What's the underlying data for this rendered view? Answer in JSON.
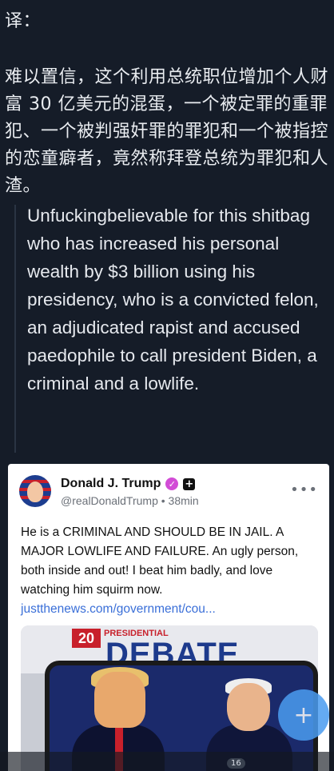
{
  "translation": {
    "label": "译：",
    "text": "难以置信，这个利用总统职位增加个人财富 30 亿美元的混蛋，一个被定罪的重罪犯、一个被判强奸罪的罪犯和一个被指控的恋童癖者，竟然称拜登总统为罪犯和人渣。"
  },
  "quote": {
    "text": "Unfuckingbelievable for this shitbag who has increased his personal wealth by $3 billion using his presidency, who is a convicted felon, an adjudicated rapist and accused paedophile to call president Biden, a criminal and a lowlife."
  },
  "post": {
    "author_name": "Donald J. Trump",
    "handle": "@realDonaldTrump",
    "separator": "•",
    "time": "38min",
    "more_glyph": "•••",
    "body": "He is a CRIMINAL AND SHOULD BE IN JAIL. A MAJOR LOWLIFE AND FAILURE. An ugly person, both inside and out! I beat him badly, and love watching him squirm now.",
    "link": "justthenews.com/government/cou...",
    "media": {
      "number": "20",
      "banner_small": "PRESIDENTIAL",
      "banner_title": "DEBATE"
    }
  },
  "fab_label": "+",
  "count_badge": "16",
  "colors": {
    "background": "#151c28",
    "verified_badge": "#d24cd6",
    "link": "#3a6fd8",
    "fab": "#4a9cf0"
  }
}
